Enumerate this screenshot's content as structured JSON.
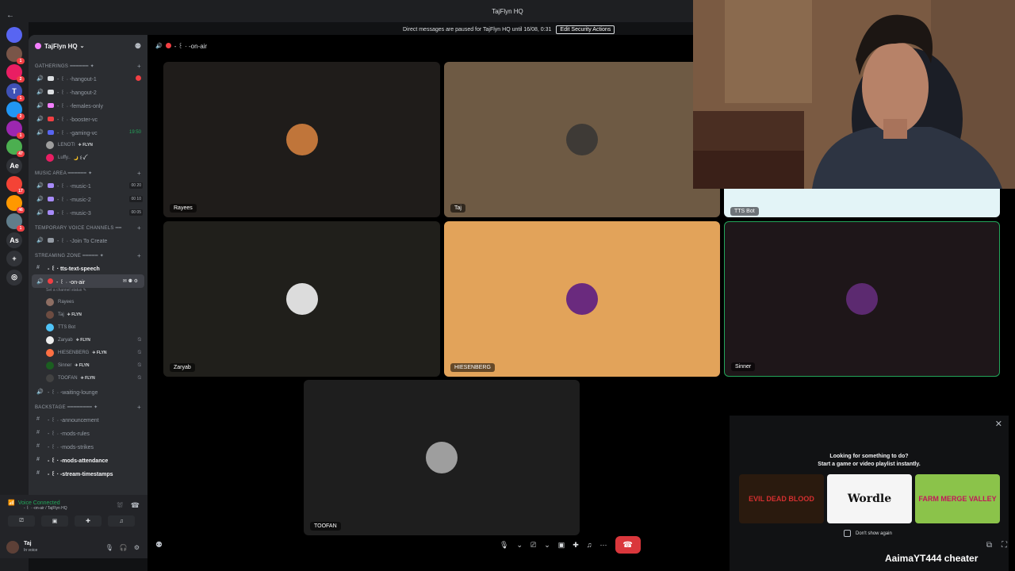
{
  "window": {
    "title": "TajFlyn HQ",
    "back_icon": "arrow-left-icon"
  },
  "notice": {
    "text": "Direct messages are paused for TajFlyn HQ until 16/08, 0:31",
    "button": "Edit Security Actions"
  },
  "server_rail": {
    "items": [
      {
        "label": "",
        "color": "#5865f2",
        "badge": ""
      },
      {
        "label": "",
        "color": "#795548",
        "badge": "1"
      },
      {
        "label": "",
        "color": "#e91e63",
        "badge": "2"
      },
      {
        "label": "T",
        "color": "#3f51b5",
        "badge": "1"
      },
      {
        "label": "",
        "color": "#2196f3",
        "badge": "2"
      },
      {
        "label": "",
        "color": "#9c27b0",
        "badge": "1"
      },
      {
        "label": "",
        "color": "#4caf50",
        "badge": "47"
      },
      {
        "label": "Ae",
        "color": "#313338",
        "badge": ""
      },
      {
        "label": "",
        "color": "#f44336",
        "badge": "17"
      },
      {
        "label": "",
        "color": "#ff9800",
        "badge": "46"
      },
      {
        "label": "",
        "color": "#607d8b",
        "badge": "1"
      },
      {
        "label": "As",
        "color": "#313338",
        "badge": ""
      },
      {
        "label": "+",
        "color": "#313338",
        "badge": ""
      },
      {
        "label": "◎",
        "color": "#313338",
        "badge": ""
      }
    ]
  },
  "sidebar": {
    "guild_name": "TajFlyn HQ",
    "categories": {
      "gatherings": "GATHERINGS ━━━━━━ ✦",
      "music": "MUSIC AREA ━━━━━━ ✦",
      "temp": "TEMPORARY VOICE CHANNELS ━━",
      "streaming": "STREAMING ZONE ━━━━━ ✦",
      "backstage": "BACKSTAGE ━━━━━━━━ ✦"
    },
    "gathering_channels": [
      {
        "name": "- ꒰ · -hangout-1",
        "right": "",
        "red": true,
        "emo": "#dbdee1"
      },
      {
        "name": "- ꒰ · -hangout-2",
        "right": "",
        "red": false,
        "emo": "#dbdee1"
      },
      {
        "name": "- ꒰ · -females-only",
        "right": "",
        "red": false,
        "emo": "#f47fff"
      },
      {
        "name": "- ꒰ · -booster-vc",
        "right": "",
        "red": false,
        "emo": "#f23f43"
      },
      {
        "name": "- ꒰ · -gaming-vc",
        "right": "19:50",
        "red": false,
        "emo": "#5865f2"
      }
    ],
    "gaming_users": [
      {
        "name": "LENOTI",
        "tag": "✈ FLYN",
        "color": "#9e9e9e"
      },
      {
        "name": "Luffy..",
        "tag": "🌙 ꒰ꪜ",
        "color": "#e91e63"
      }
    ],
    "music_channels": [
      {
        "name": "- ꒰ · -music-1",
        "lim": "00  20"
      },
      {
        "name": "- ꒰ · -music-2",
        "lim": "00  10"
      },
      {
        "name": "- ꒰ · -music-3",
        "lim": "00  05"
      }
    ],
    "temp_channels": [
      {
        "name": "- ꒰ · -Join To Create"
      }
    ],
    "streaming_channels": {
      "tts": "- ꒰ · tts-text-speech",
      "onair": "- ꒰ · -on-air",
      "status": "Set a channel status ✎"
    },
    "onair_users": [
      {
        "name": "Rayees",
        "tag": "",
        "color": "#8d6e63",
        "muted": false
      },
      {
        "name": "Taj",
        "tag": "✈ FLYN",
        "color": "#6d4c41",
        "muted": false
      },
      {
        "name": "TTS Bot",
        "tag": "",
        "color": "#4fc3f7",
        "muted": false
      },
      {
        "name": "Zaryab",
        "tag": "✈ FLYN",
        "color": "#eeeeee",
        "muted": true
      },
      {
        "name": "HIESENBERG",
        "tag": "✈ FLYN",
        "color": "#ff7043",
        "muted": true
      },
      {
        "name": "Sinner",
        "tag": "✈ FLYN",
        "color": "#1b5e20",
        "muted": true
      },
      {
        "name": "TOOFAN",
        "tag": "✈ FLYN",
        "color": "#424242",
        "muted": true
      }
    ],
    "waiting": "- ꒰ · -waiting-lounge",
    "backstage_channels": [
      {
        "name": "- ꒰ · -announcement",
        "bold": false
      },
      {
        "name": "- ꒰ · -mods-rules",
        "bold": false
      },
      {
        "name": "- ꒰ · -mods-strikes",
        "bold": false
      },
      {
        "name": "- ꒰ · -mods-attendance",
        "bold": true
      },
      {
        "name": "- ꒰ · -stream-timestamps",
        "bold": true
      }
    ]
  },
  "voice_panel": {
    "status": "Voice Connected",
    "sub": "- ꒰ · -on-air / TajFlyn HQ"
  },
  "user_panel": {
    "name": "Taj",
    "status": "In voice"
  },
  "stage": {
    "channel": "- ꒰ · -on-air",
    "tiles": [
      {
        "label": "Rayees",
        "bg": "#1f1c1a",
        "avatar": "#c0753a"
      },
      {
        "label": "Taj",
        "bg": "#6e5a44",
        "avatar": "#3e3a36"
      },
      {
        "label": "TTS Bot",
        "bg": "#e3f4f7",
        "avatar": ""
      },
      {
        "label": "Zaryab",
        "bg": "#201f1b",
        "avatar": "#dcdcdc"
      },
      {
        "label": "HIESENBERG",
        "bg": "#e2a35a",
        "avatar": "#6a2a7e"
      },
      {
        "label": "Sinner",
        "bg": "#1e1619",
        "avatar": "#5c2a70"
      },
      {
        "label": "TOOFAN",
        "bg": "#1e1e1e",
        "avatar": "#9e9e9e"
      }
    ]
  },
  "activity": {
    "line1": "Looking for something to do?",
    "line2": "Start a game or video playlist instantly.",
    "games": [
      {
        "name": "EVIL DEAD BLOOD",
        "bg": "#2a1a0e",
        "fg": "#d32f2f"
      },
      {
        "name": "Wordle",
        "bg": "#f5f5f5",
        "fg": "#111"
      },
      {
        "name": "FARM MERGE VALLEY",
        "bg": "#8bc34a",
        "fg": "#c2185b"
      }
    ],
    "dont_show": "Don't show again"
  },
  "watermark": "AaimaYT444  cheater"
}
